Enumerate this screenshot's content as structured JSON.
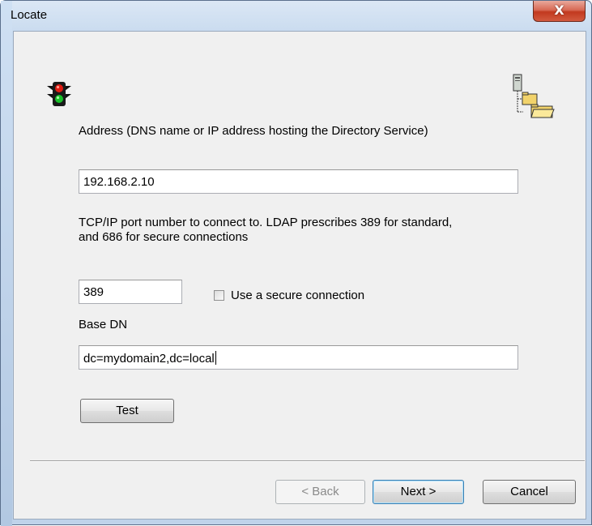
{
  "window": {
    "title": "Locate",
    "close_glyph": "X"
  },
  "icons": {
    "traffic_light": "traffic-light-icon",
    "directory_tree": "directory-tree-icon"
  },
  "form": {
    "address_label": "Address (DNS name or IP address hosting the Directory Service)",
    "address_value": "192.168.2.10",
    "port_label_line1": "TCP/IP port number to connect to. LDAP prescribes 389 for standard,",
    "port_label_line2": "and 686 for secure connections",
    "port_value": "389",
    "secure_checkbox_label": "Use a secure connection",
    "secure_checked": false,
    "base_dn_label": "Base DN",
    "base_dn_value": "dc=mydomain2,dc=local",
    "test_button": "Test"
  },
  "footer": {
    "back_button": "< Back",
    "next_button": "Next >",
    "cancel_button": "Cancel"
  },
  "colors": {
    "dialog_bg": "#f0f0f0",
    "frame": "#bfd3ea",
    "close_red": "#c2391f",
    "default_button_border": "#3c7fb1"
  }
}
